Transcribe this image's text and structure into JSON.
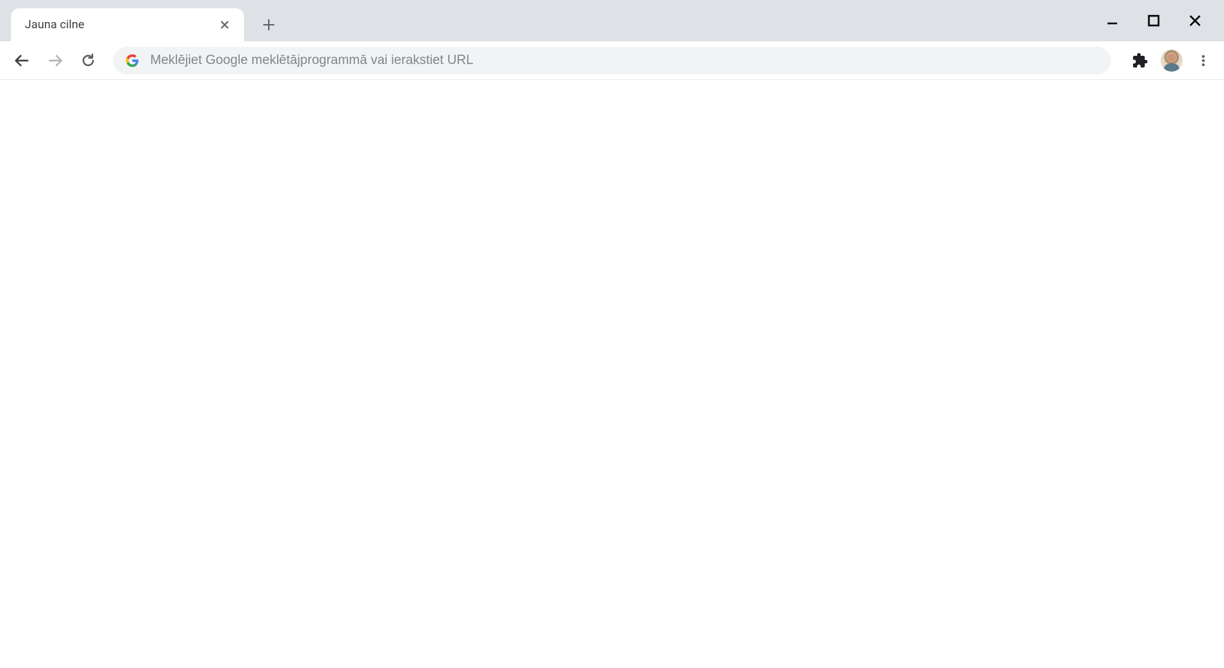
{
  "tabs": [
    {
      "title": "Jauna cilne"
    }
  ],
  "addressBar": {
    "placeholder": "Meklējiet Google meklētājprogrammā vai ierakstiet URL",
    "value": ""
  }
}
